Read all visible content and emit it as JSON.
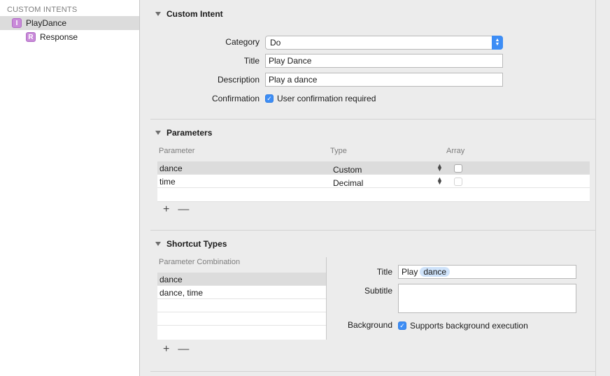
{
  "sidebar": {
    "header": "CUSTOM INTENTS",
    "items": [
      {
        "badge": "I",
        "label": "PlayDance"
      },
      {
        "badge": "R",
        "label": "Response"
      }
    ]
  },
  "custom_intent": {
    "title": "Custom Intent",
    "category_label": "Category",
    "category_value": "Do",
    "title_label": "Title",
    "title_value": "Play Dance",
    "description_label": "Description",
    "description_value": "Play a dance",
    "confirmation_label": "Confirmation",
    "confirmation_text": "User confirmation required"
  },
  "parameters": {
    "title": "Parameters",
    "columns": [
      "Parameter",
      "Type",
      "Array"
    ],
    "rows": [
      {
        "name": "dance",
        "type": "Custom"
      },
      {
        "name": "time",
        "type": "Decimal"
      }
    ],
    "add": "+",
    "remove": "—"
  },
  "shortcut_types": {
    "title": "Shortcut Types",
    "column": "Parameter Combination",
    "rows": [
      "dance",
      "dance, time"
    ],
    "title_label": "Title",
    "title_prefix": "Play",
    "title_token": "dance",
    "subtitle_label": "Subtitle",
    "background_label": "Background",
    "background_text": "Supports background execution",
    "add": "+",
    "remove": "—"
  },
  "colors": {
    "accent": "#3d8df5",
    "badge": "#c98ad9",
    "selection": "#dcdcdc"
  }
}
